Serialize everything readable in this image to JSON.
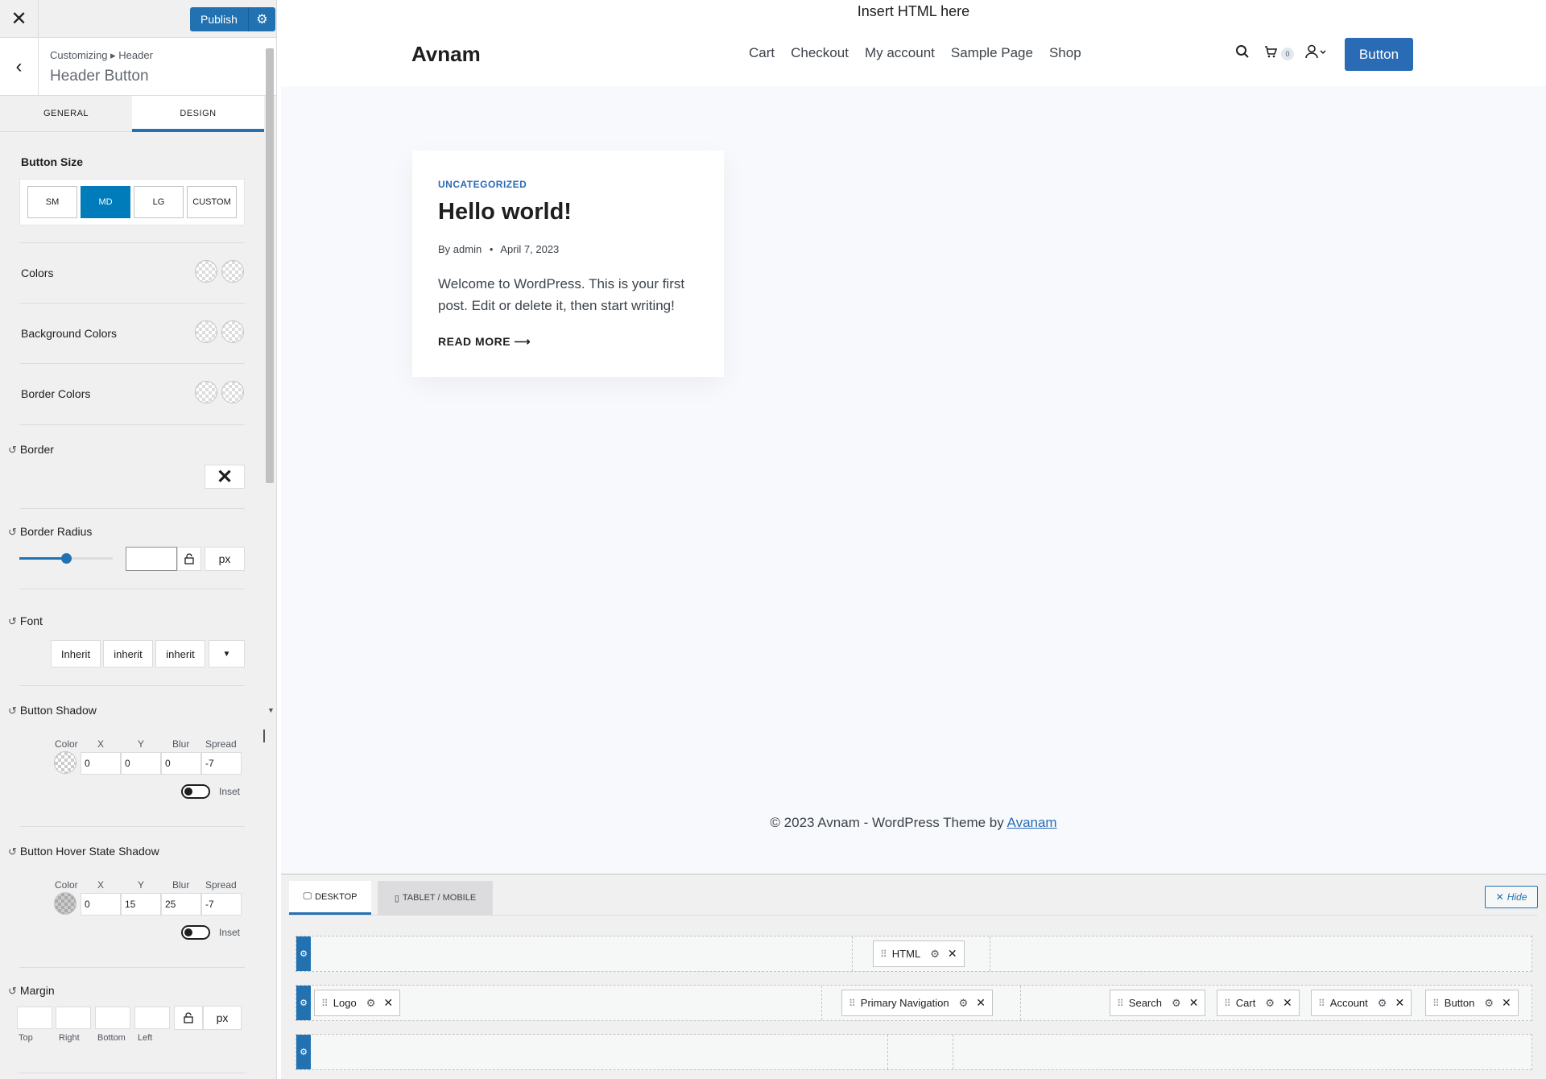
{
  "sidebar": {
    "publish_label": "Publish",
    "breadcrumb": "Customizing ▸ Header",
    "title": "Header Button",
    "tabs": [
      "GENERAL",
      "DESIGN"
    ],
    "button_size": {
      "label": "Button Size",
      "options": [
        "SM",
        "MD",
        "LG",
        "CUSTOM"
      ],
      "selected": "MD"
    },
    "colors_label": "Colors",
    "background_colors_label": "Background Colors",
    "border_colors_label": "Border Colors",
    "border_label": "Border",
    "border_radius": {
      "label": "Border Radius",
      "slider_percent": 50,
      "value": "",
      "unit": "px"
    },
    "font": {
      "label": "Font",
      "family": "Inherit",
      "weight": "inherit",
      "style": "inherit"
    },
    "button_shadow": {
      "label": "Button Shadow",
      "headers": [
        "Color",
        "X",
        "Y",
        "Blur",
        "Spread"
      ],
      "values": [
        "0",
        "0",
        "0",
        "-7"
      ],
      "inset_label": "Inset"
    },
    "hover_shadow": {
      "label": "Button Hover State Shadow",
      "headers": [
        "Color",
        "X",
        "Y",
        "Blur",
        "Spread"
      ],
      "values": [
        "0",
        "15",
        "25",
        "-7"
      ],
      "inset_label": "Inset"
    },
    "margin": {
      "label": "Margin",
      "unit": "px",
      "sides": [
        "Top",
        "Right",
        "Bottom",
        "Left"
      ]
    }
  },
  "preview": {
    "top_html": "Insert HTML here",
    "logo": "Avnam",
    "nav": [
      "Cart",
      "Checkout",
      "My account",
      "Sample Page",
      "Shop"
    ],
    "cart_count": "0",
    "header_button": "Button",
    "post": {
      "category": "UNCATEGORIZED",
      "title": "Hello world!",
      "author": "By admin",
      "date": "April 7, 2023",
      "excerpt": "Welcome to WordPress. This is your first post. Edit or delete it, then start writing!",
      "read_more": "READ MORE ⟶"
    },
    "footer_text": "© 2023 Avnam - WordPress Theme by ",
    "footer_link": "Avanam"
  },
  "builder": {
    "tabs": [
      "DESKTOP",
      "TABLET / MOBILE"
    ],
    "hide_label": "Hide",
    "chips": {
      "html": "HTML",
      "logo": "Logo",
      "primary_nav": "Primary Navigation",
      "search": "Search",
      "cart": "Cart",
      "account": "Account",
      "button": "Button"
    }
  },
  "colors": {
    "accent": "#2271b1",
    "md_active": "#007cba",
    "site_button": "#2a6bb5"
  }
}
